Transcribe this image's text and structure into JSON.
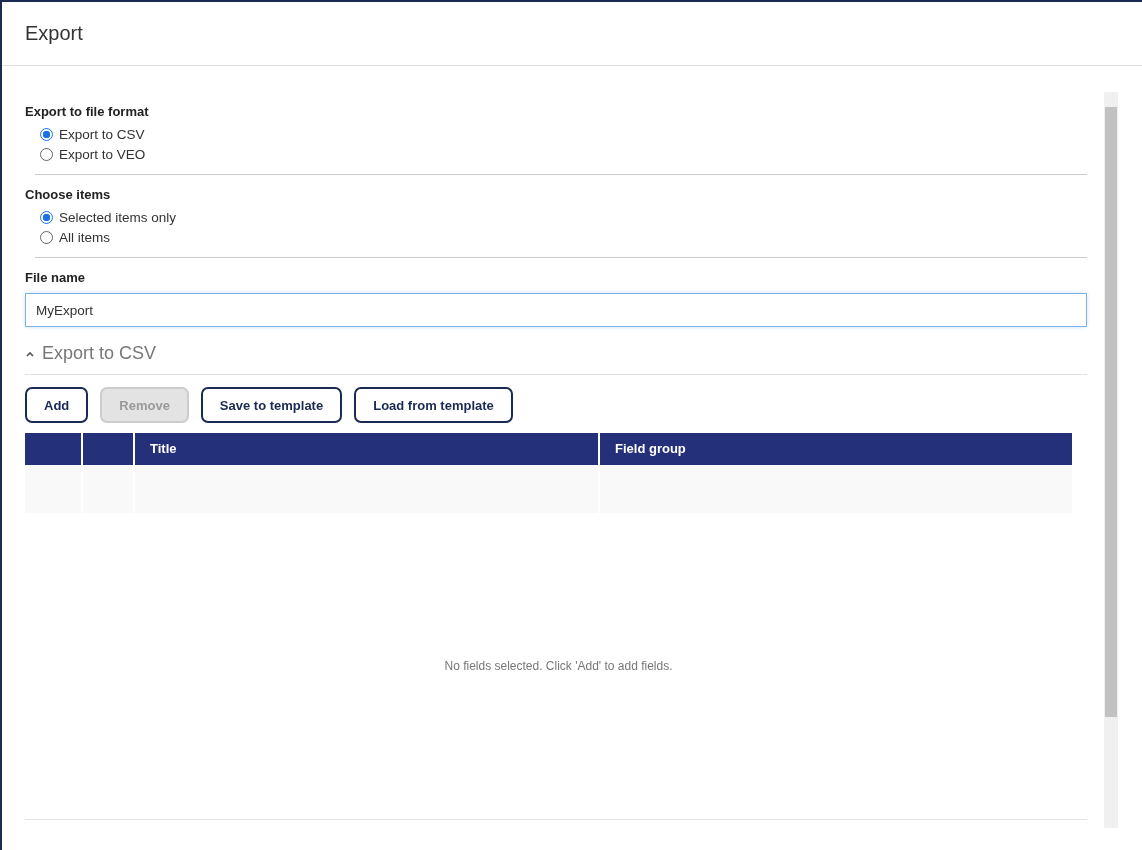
{
  "window": {
    "title": "Export"
  },
  "format_group": {
    "label": "Export to file format",
    "options": [
      {
        "label": "Export to CSV",
        "selected": true
      },
      {
        "label": "Export to VEO",
        "selected": false
      }
    ]
  },
  "items_group": {
    "label": "Choose items",
    "options": [
      {
        "label": "Selected items only",
        "selected": true
      },
      {
        "label": "All items",
        "selected": false
      }
    ]
  },
  "file_name": {
    "label": "File name",
    "value": "MyExport"
  },
  "csv_section": {
    "title": "Export to CSV",
    "expanded": true,
    "buttons": [
      {
        "label": "Add",
        "disabled": false
      },
      {
        "label": "Remove",
        "disabled": true
      },
      {
        "label": "Save to template",
        "disabled": false
      },
      {
        "label": "Load from template",
        "disabled": false
      }
    ],
    "table": {
      "columns": [
        {
          "kind": "blank"
        },
        {
          "kind": "blank"
        },
        {
          "kind": "text",
          "label": "Title"
        },
        {
          "kind": "text",
          "label": "Field group"
        }
      ],
      "empty_message": "No fields selected. Click 'Add' to add fields."
    }
  }
}
